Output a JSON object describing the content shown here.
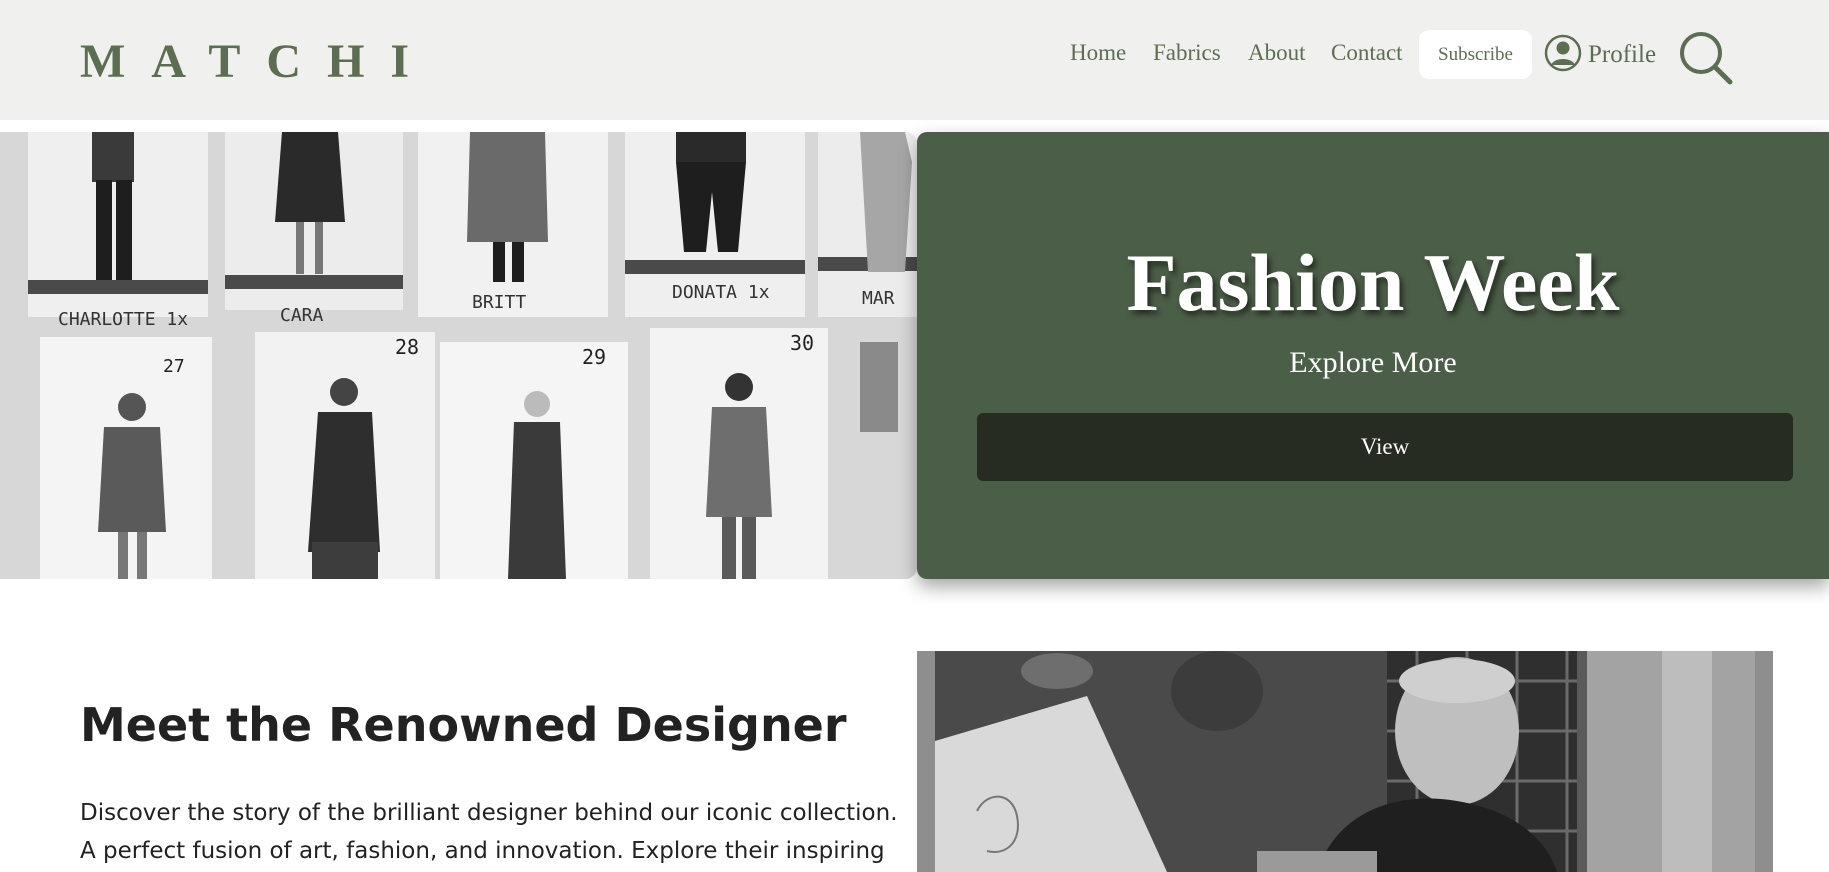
{
  "header": {
    "logo": "MATCHI",
    "nav": [
      {
        "label": "Home"
      },
      {
        "label": "Fabrics"
      },
      {
        "label": "About"
      },
      {
        "label": "Contact"
      }
    ],
    "subscribe_label": "Subscribe",
    "profile_label": "Profile",
    "icons": {
      "profile": "user-circle-icon",
      "search": "search-icon"
    }
  },
  "hero": {
    "image_labels": [
      "CHARLOTTE 1x",
      "CARA",
      "BRITT",
      "DONATA 1x",
      "MAR",
      "27",
      "28",
      "29",
      "30"
    ],
    "title": "Fashion Week",
    "subtitle": "Explore More",
    "button_label": "View"
  },
  "designer": {
    "heading": "Meet the Renowned Designer",
    "text": "Discover the story of the brilliant designer behind our iconic collection. A perfect fusion of art, fashion, and innovation. Explore their inspiring journey"
  },
  "colors": {
    "brand_green": "#5c6e52",
    "hero_card": "#4b5e47",
    "hero_button": "#272c22",
    "header_bg": "#f0f0ee"
  }
}
